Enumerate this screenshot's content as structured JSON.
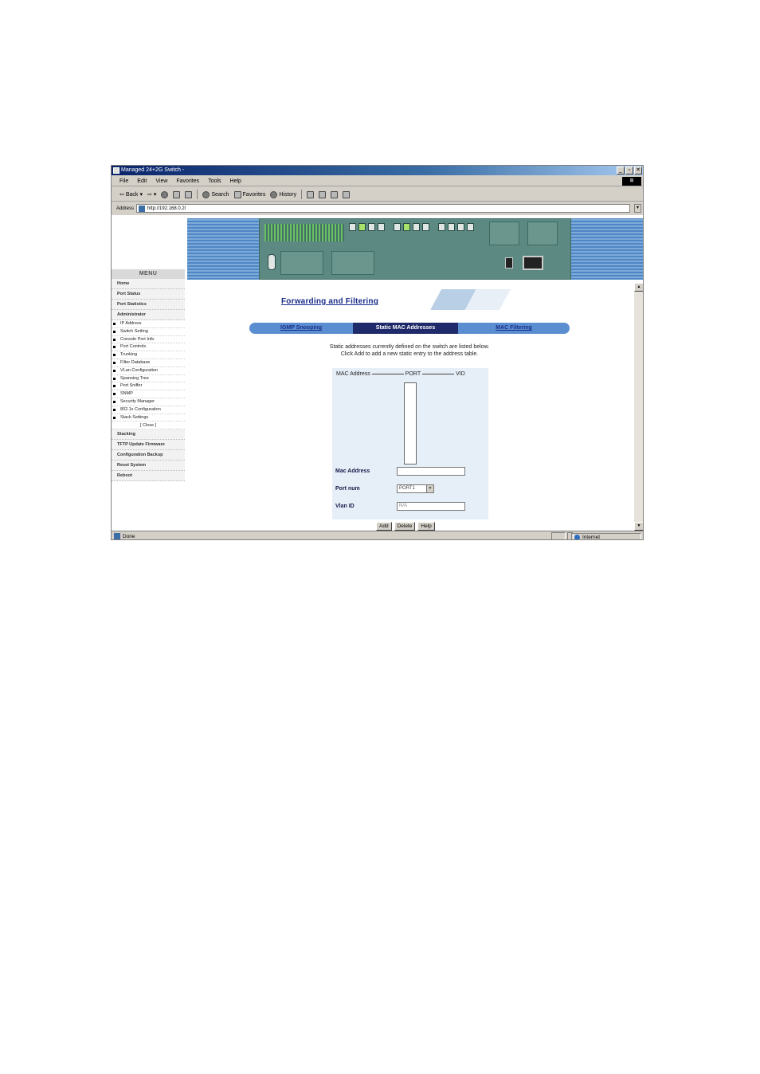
{
  "window": {
    "title": "Managed 24+2G Switch -",
    "controls": [
      "_",
      "▫",
      "✕"
    ]
  },
  "menubar": {
    "items": [
      "File",
      "Edit",
      "View",
      "Favorites",
      "Tools",
      "Help"
    ]
  },
  "toolbar": {
    "back": "Back",
    "search": "Search",
    "favorites": "Favorites",
    "history": "History"
  },
  "address": {
    "label": "Address",
    "url": "http://192.168.0.2/"
  },
  "sidebar": {
    "menu_title": "MENU",
    "top_items": [
      "Home",
      "Port Status",
      "Port Statistics",
      "Administrator"
    ],
    "sub_items": [
      "IP Address",
      "Switch Setting",
      "Console Port Info",
      "Port Controls",
      "Trunking",
      "Filter Database",
      "VLan Configuration",
      "Spanning Tree",
      "Port Sniffer",
      "SNMP",
      "Security Manager",
      "802.1x Configuration",
      "Stack Settings"
    ],
    "close_label": "[ Close ]",
    "bottom_items": [
      "Stacking",
      "TFTP Update Firmware",
      "Configuration Backup",
      "Reset System",
      "Reboot"
    ]
  },
  "page": {
    "title": "Forwarding and Filtering",
    "tabs": [
      {
        "label": "IGMP Snooping",
        "active": false
      },
      {
        "label": "Static MAC Addresses",
        "active": true
      },
      {
        "label": "MAC Filtering",
        "active": false
      }
    ],
    "desc_line1": "Static addresses currently defined on the switch are listed below.",
    "desc_line2": "Click Add to add a new static entry to the address table."
  },
  "form": {
    "col_mac": "MAC Address",
    "col_port": "PORT",
    "col_vid": "VID",
    "mac_label": "Mac Address",
    "mac_value": "",
    "port_label": "Port num",
    "port_value": "PORT1",
    "vlan_label": "Vlan ID",
    "vlan_placeholder": "N/A",
    "buttons": {
      "add": "Add",
      "delete": "Delete",
      "help": "Help"
    }
  },
  "status": {
    "left": "Done",
    "zone": "Internet"
  },
  "colors": {
    "title_bar": "#0a246a",
    "banner": "#4f86c6",
    "tab_active": "#1e2a6a",
    "tab_inactive": "#5b8ed0",
    "form_bg": "#e6eef7",
    "title_text": "#1a2f8a"
  }
}
